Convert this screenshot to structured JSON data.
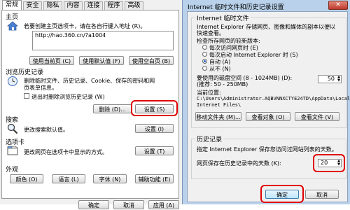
{
  "left": {
    "tabs": [
      "常规",
      "安全",
      "隐私",
      "内容",
      "连接",
      "程序",
      "高级"
    ],
    "homepage": {
      "title": "主页",
      "desc": "若要创建主页选项卡，请在各自行键入地址 (R)。",
      "url": "http://hao.360.cn/?a1004",
      "use_current": "使用当前页 (C)",
      "use_default": "使用默认值 (F)",
      "use_blank": "使用空白页 (B)"
    },
    "history": {
      "title": "浏览历史记录",
      "desc_line1": "删除临时文件、历史记录、Cookie、保存的密码和网",
      "desc_line2": "页表单信息。",
      "exit_delete": "退出时删除浏览历史记录 (W)",
      "delete_btn": "删除 (D)...",
      "settings_btn": "设置 (S)"
    },
    "search": {
      "title": "搜索",
      "desc": "更改搜索默认值。",
      "settings_btn": "设置 (I)"
    },
    "tabs_group": {
      "title": "选项卡",
      "desc": "更改网页在选项卡中显示的方式。",
      "settings_btn": "设置 (T)"
    },
    "appearance": {
      "title": "外观",
      "colors": "颜色 (O)",
      "languages": "语言 (L)",
      "fonts": "字体 (N)",
      "accessibility": "辅助功能 (E)"
    },
    "bottom_buttons": [
      "确定",
      "取消",
      "应用 (A)"
    ]
  },
  "right": {
    "title": "Internet 临时文件和历史记录设置",
    "temp_files": {
      "title": "Internet 临时文件",
      "desc_line1": "Internet Explorer 存储网页、图像和媒体的副本以便以",
      "desc_line2": "快速查看。",
      "check_label": "检查所存网页的较新版本:",
      "options": [
        "每次访问网页时 (E)",
        "每次启动 Internet Explorer 时 (S)",
        "自动 (A)",
        "从不 (N)"
      ],
      "selected_index": 2,
      "disk_label_line1": "要使用的磁盘空间 (8 - 1024MB) (D):",
      "disk_label_line2": "(推荐: 50 - 250MB)",
      "disk_value": "50",
      "location_label": "当前位置:",
      "location_line1": "C:\\Users\\Administrator.AQBVNNXCTYE24TD\\AppData\\Local\\",
      "location_line2": "Internet Files\\",
      "move_folder": "移动文件夹 (M)...",
      "view_objects": "查看对象 (O)",
      "view_files": "查看文件 (V)"
    },
    "history": {
      "title": "历史记录",
      "desc": "指定 Internet Explorer 保存您访问过网站列表的天数。",
      "days_label": "网页保存在历史记录中的天数 (K):",
      "days_value": "20"
    },
    "ok": "确定",
    "cancel": "取消",
    "close": "✕"
  }
}
